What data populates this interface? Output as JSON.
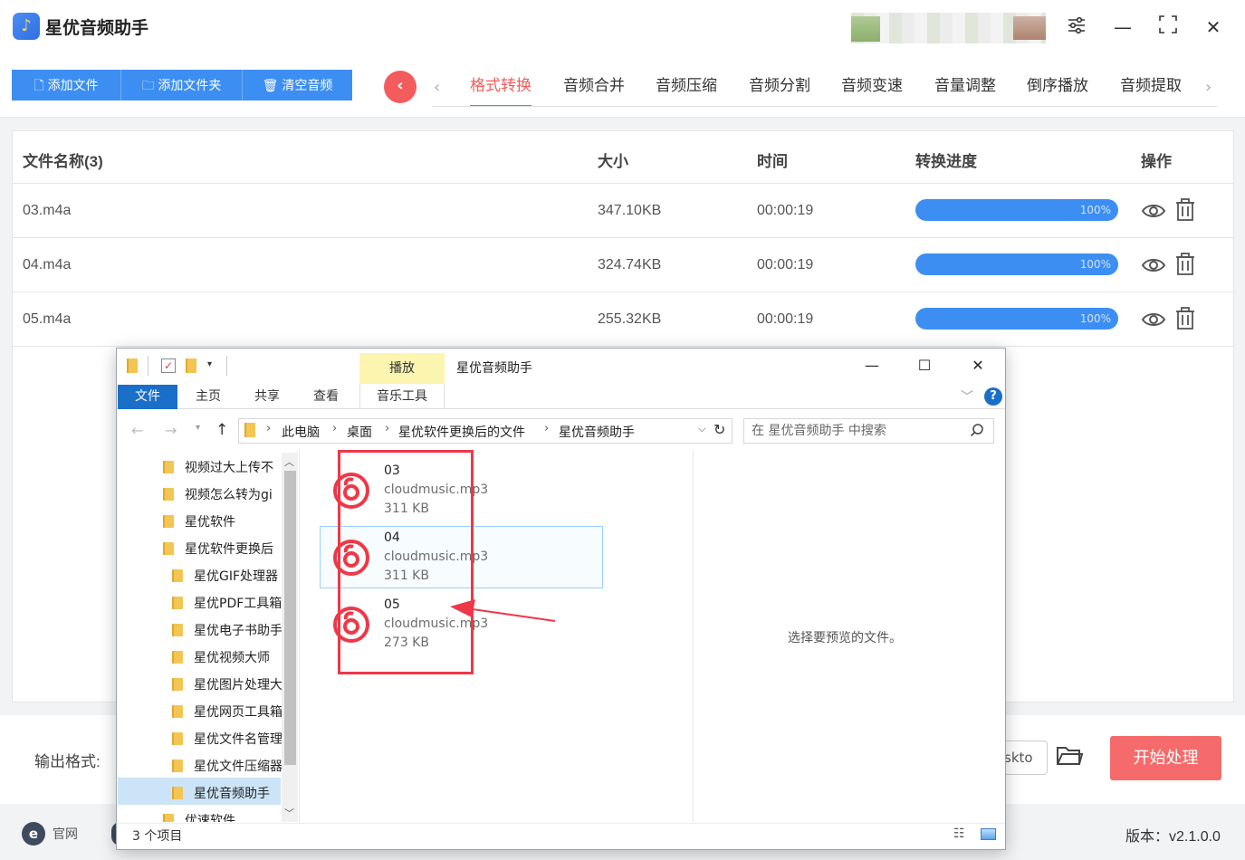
{
  "app": {
    "title": "星优音频助手",
    "version": "版本：v2.1.0.0"
  },
  "toolbar": {
    "add_file": "添加文件",
    "add_folder": "添加文件夹",
    "clear": "清空音频"
  },
  "tabs": [
    "格式转换",
    "音频合并",
    "音频压缩",
    "音频分割",
    "音频变速",
    "音量调整",
    "倒序播放",
    "音频提取"
  ],
  "table": {
    "headers": {
      "name": "文件名称(3)",
      "size": "大小",
      "time": "时间",
      "progress": "转换进度",
      "action": "操作"
    },
    "rows": [
      {
        "name": "03.m4a",
        "size": "347.10KB",
        "time": "00:00:19",
        "progress": "100%",
        "progress_value": 1.0
      },
      {
        "name": "04.m4a",
        "size": "324.74KB",
        "time": "00:00:19",
        "progress": "100%",
        "progress_value": 1.0
      },
      {
        "name": "05.m4a",
        "size": "255.32KB",
        "time": "00:00:19",
        "progress": "100%",
        "progress_value": 1.0
      }
    ]
  },
  "bottom": {
    "output_format_label": "输出格式:",
    "output_path_fragment": "skto",
    "start_button": "开始处理",
    "official_site": "官网"
  },
  "explorer": {
    "title": "星优音频助手",
    "contextual_tab": "播放",
    "ribbon_tabs": {
      "file": "文件",
      "home": "主页",
      "share": "共享",
      "view": "查看",
      "music_tools": "音乐工具"
    },
    "breadcrumb": [
      "此电脑",
      "桌面",
      "星优软件更换后的文件",
      "星优音频助手"
    ],
    "search_placeholder": "在 星优音频助手 中搜索",
    "tree": [
      "视频过大上传不",
      "视频怎么转为gi",
      "星优软件",
      "星优软件更换后",
      "星优GIF处理器",
      "星优PDF工具箱",
      "星优电子书助手",
      "星优视频大师",
      "星优图片处理大",
      "星优网页工具箱",
      "星优文件名管理",
      "星优文件压缩器",
      "星优音频助手",
      "优速软件"
    ],
    "files": [
      {
        "name": "03",
        "type": "cloudmusic.mp3",
        "size": "311 KB"
      },
      {
        "name": "04",
        "type": "cloudmusic.mp3",
        "size": "311 KB"
      },
      {
        "name": "05",
        "type": "cloudmusic.mp3",
        "size": "273 KB"
      }
    ],
    "preview_hint": "选择要预览的文件。",
    "status": "3 个项目"
  },
  "colors": {
    "accent_blue": "#3d8ef2",
    "accent_red": "#f25c5c",
    "annotation_red": "#ee3848",
    "explorer_blue": "#1a6fc9"
  }
}
